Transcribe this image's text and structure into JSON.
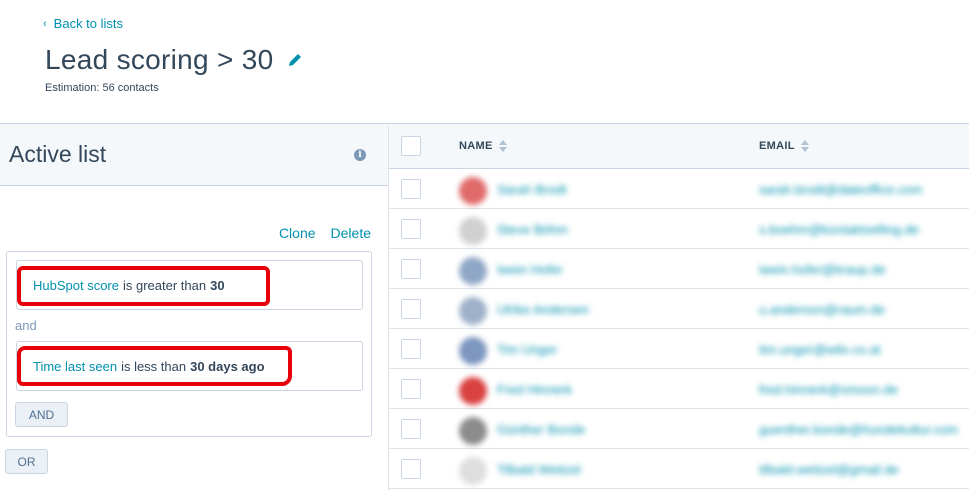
{
  "header": {
    "back_label": "Back to lists",
    "title": "Lead scoring > 30",
    "estimation": "Estimation: 56 contacts"
  },
  "left_panel": {
    "title": "Active list",
    "clone_label": "Clone",
    "delete_label": "Delete",
    "filters": [
      {
        "property": "HubSpot score",
        "operator": "is greater than",
        "value": "30"
      },
      {
        "property": "Time last seen",
        "operator": "is less than",
        "value": "30 days ago"
      }
    ],
    "and_text": "and",
    "and_button": "AND",
    "or_button": "OR",
    "annotation_color": "#e8000b"
  },
  "table": {
    "columns": [
      "NAME",
      "EMAIL"
    ],
    "rows": [
      {
        "avatar_color": "#e06a6a",
        "name": "Sarah Brodt",
        "email": "sarah.brodt@dateoffice.com"
      },
      {
        "avatar_color": "#d0d0d0",
        "name": "Steve Böhm",
        "email": "s.boehm@kontaktselling.de"
      },
      {
        "avatar_color": "#8fa7c6",
        "name": "Iwein Hofer",
        "email": "iwein.hofer@kraup.de"
      },
      {
        "avatar_color": "#9fb1c9",
        "name": "Ulrike Andersen",
        "email": "u.anderson@raum.de"
      },
      {
        "avatar_color": "#7d97c0",
        "name": "Tim Unger",
        "email": "tim.unger@wilo.co.at"
      },
      {
        "avatar_color": "#d9423f",
        "name": "Fred Hinnerk",
        "email": "fred.hinnerk@smoon.de"
      },
      {
        "avatar_color": "#8c8c8c",
        "name": "Günther Bonde",
        "email": "guenther.bonde@hundekultur.com"
      },
      {
        "avatar_color": "#dedede",
        "name": "Tilbald Weitzel",
        "email": "tilbald.weitzel@gmail.de"
      }
    ]
  }
}
